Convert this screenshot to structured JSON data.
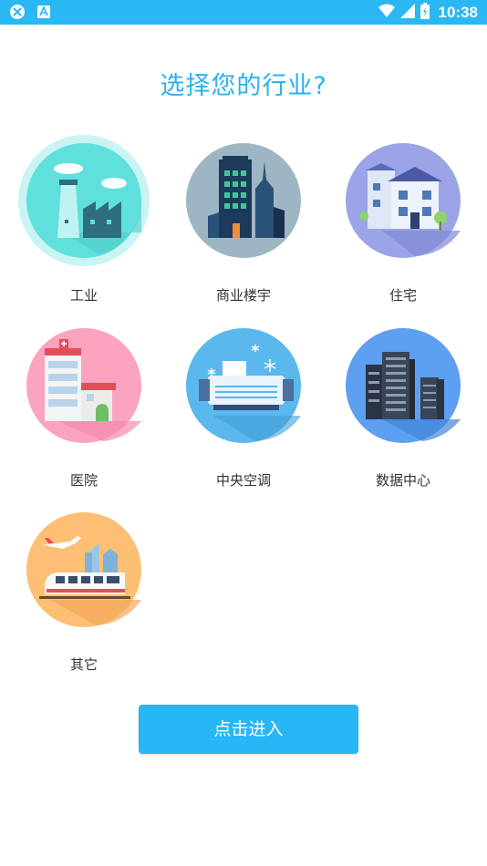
{
  "status_bar": {
    "time": "10:38",
    "left_icons": [
      "app-notification-icon",
      "a-notification-icon"
    ],
    "right_icons": [
      "wifi-icon",
      "cellular-signal-icon",
      "battery-charging-icon"
    ]
  },
  "page": {
    "title": "选择您的行业?"
  },
  "industries": [
    {
      "label": "工业",
      "icon": "factory-icon",
      "color": "#5fe0dc",
      "selected": true
    },
    {
      "label": "商业楼宇",
      "icon": "office-building-icon",
      "color": "#9eb6c4",
      "selected": false
    },
    {
      "label": "住宅",
      "icon": "residence-icon",
      "color": "#9aa4e6",
      "selected": false
    },
    {
      "label": "医院",
      "icon": "hospital-icon",
      "color": "#fba3bf",
      "selected": false
    },
    {
      "label": "中央空调",
      "icon": "air-conditioner-icon",
      "color": "#5ab8ec",
      "selected": false
    },
    {
      "label": "数据中心",
      "icon": "server-rack-icon",
      "color": "#5d9ff0",
      "selected": false
    },
    {
      "label": "其它",
      "icon": "transport-icon",
      "color": "#fcbf73",
      "selected": false
    }
  ],
  "enter_button": {
    "label": "点击进入"
  }
}
